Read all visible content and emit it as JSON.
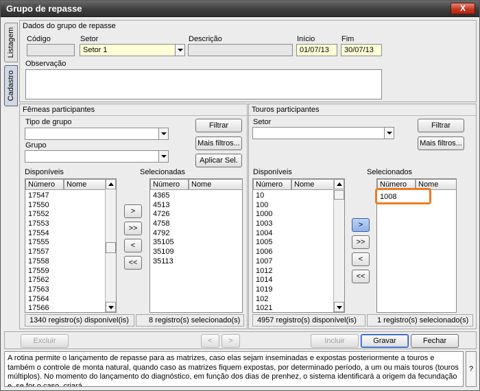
{
  "window": {
    "title": "Grupo de repasse",
    "close_label": "X"
  },
  "side_tabs": {
    "listagem": "Listagem",
    "cadastro": "Cadastro"
  },
  "dados": {
    "section_title": "Dados do grupo de repasse",
    "codigo_label": "Código",
    "codigo_value": "",
    "setor_label": "Setor",
    "setor_value": "Setor 1",
    "descricao_label": "Descrição",
    "descricao_value": "",
    "inicio_label": "Início",
    "inicio_value": "01/07/13",
    "fim_label": "Fim",
    "fim_value": "30/07/13",
    "observacao_label": "Observação",
    "observacao_value": ""
  },
  "femeas": {
    "section_title": "Fêmeas participantes",
    "tipo_label": "Tipo de grupo",
    "tipo_value": "",
    "grupo_label": "Grupo",
    "grupo_value": "",
    "filtrar": "Filtrar",
    "mais_filtros": "Mais filtros...",
    "aplicar_sel": "Aplicar Sel.",
    "disponiveis_label": "Disponíveis",
    "selecionadas_label": "Selecionadas",
    "col_numero": "Número",
    "col_nome": "Nome",
    "available": [
      "17547",
      "17550",
      "17552",
      "17553",
      "17554",
      "17555",
      "17557",
      "17558",
      "17559",
      "17562",
      "17563",
      "17564",
      "17566"
    ],
    "selected": [
      "4365",
      "4513",
      "4726",
      "4758",
      "4792",
      "35105",
      "35109",
      "35113"
    ],
    "status_available": "1340 registro(s) disponível(is)",
    "status_selected": "8 registro(s) selecionado(s)",
    "move": [
      ">",
      ">>",
      "<",
      "<<"
    ]
  },
  "touros": {
    "section_title": "Touros participantes",
    "setor_label": "Setor",
    "setor_value": "",
    "filtrar": "Filtrar",
    "mais_filtros": "Mais filtros...",
    "disponiveis_label": "Disponíveis",
    "selecionados_label": "Selecionados",
    "col_numero": "Número",
    "col_nome": "Nome",
    "available": [
      "10",
      "100",
      "1000",
      "1003",
      "1004",
      "1005",
      "1006",
      "1007",
      "1012",
      "1014",
      "1019",
      "102",
      "1021"
    ],
    "selected": [
      "1008"
    ],
    "status_available": "4957 registro(s) disponível(is)",
    "status_selected": "1 registro(s) selecionado(s)",
    "move": [
      ">",
      ">>",
      "<",
      "<<"
    ],
    "highlight_color": "#ee7a22"
  },
  "footer": {
    "excluir": "Excluir",
    "prev": "<",
    "next": ">",
    "incluir": "Incluir",
    "gravar": "Gravar",
    "fechar": "Fechar"
  },
  "help": {
    "text": "A rotina permite o lançamento de repasse para as matrizes, caso elas sejam inseminadas e expostas posteriormente a touros e também o controle de monta natural, quando caso as matrizes fiquem expostas, por determinado período, a um ou mais touros (touros múltiplos). No momento do lançamento do diagnóstico, em função dos dias de prenhez, o sistema identificará a origem da fecundação e, se for o caso, criará,",
    "question": "?"
  }
}
